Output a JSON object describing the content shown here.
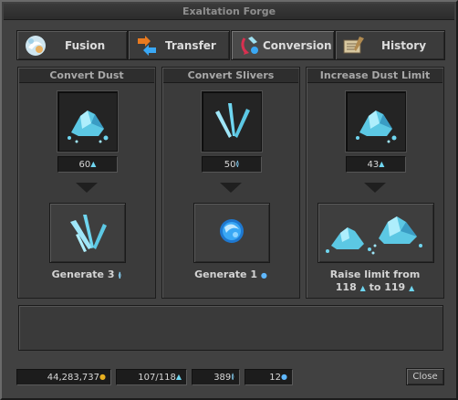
{
  "window": {
    "title": "Exaltation Forge"
  },
  "tabs": [
    {
      "label": "Fusion",
      "icon": "fusion-icon"
    },
    {
      "label": "Transfer",
      "icon": "transfer-icon"
    },
    {
      "label": "Conversion",
      "icon": "conversion-icon",
      "active": true
    },
    {
      "label": "History",
      "icon": "history-icon"
    }
  ],
  "panels": {
    "convert_dust": {
      "title": "Convert Dust",
      "cost": "60",
      "cost_icon": "dust-icon",
      "output_icon": "sliver-icon",
      "action_text": "Generate 3"
    },
    "convert_slivers": {
      "title": "Convert Slivers",
      "cost": "50",
      "cost_icon": "sliver-icon",
      "output_icon": "core-icon",
      "action_text": "Generate 1"
    },
    "increase_limit": {
      "title": "Increase Dust Limit",
      "cost": "43",
      "cost_icon": "dust-icon",
      "output_icon": "dust-pile-icon",
      "line1": "Raise limit from",
      "from": "118",
      "to_word": "to",
      "to": "119"
    }
  },
  "footer": {
    "gold": "44,283,737",
    "dust": "107/118",
    "slivers": "389",
    "cores": "12",
    "close_label": "Close"
  },
  "colors": {
    "dust": "#6fd6f0",
    "gold": "#e8b020",
    "core": "#3aa8f5"
  }
}
